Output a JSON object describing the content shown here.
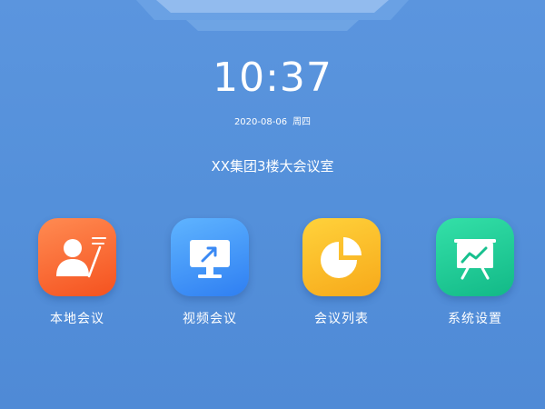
{
  "clock": {
    "time": "10:37"
  },
  "date": {
    "date": "2020-08-06",
    "weekday": "周四"
  },
  "room": {
    "name": "XX集团3楼大会议室"
  },
  "apps": [
    {
      "label": "本地会议",
      "icon": "local-meeting-icon",
      "color": "#f5521f"
    },
    {
      "label": "视频会议",
      "icon": "video-meeting-icon",
      "color": "#2f7ff2"
    },
    {
      "label": "会议列表",
      "icon": "meeting-list-pie-icon",
      "color": "#f7a91a"
    },
    {
      "label": "系统设置",
      "icon": "system-settings-chart-icon",
      "color": "#12b987"
    }
  ],
  "theme": {
    "background": "#5591db",
    "text": "#ffffff"
  }
}
